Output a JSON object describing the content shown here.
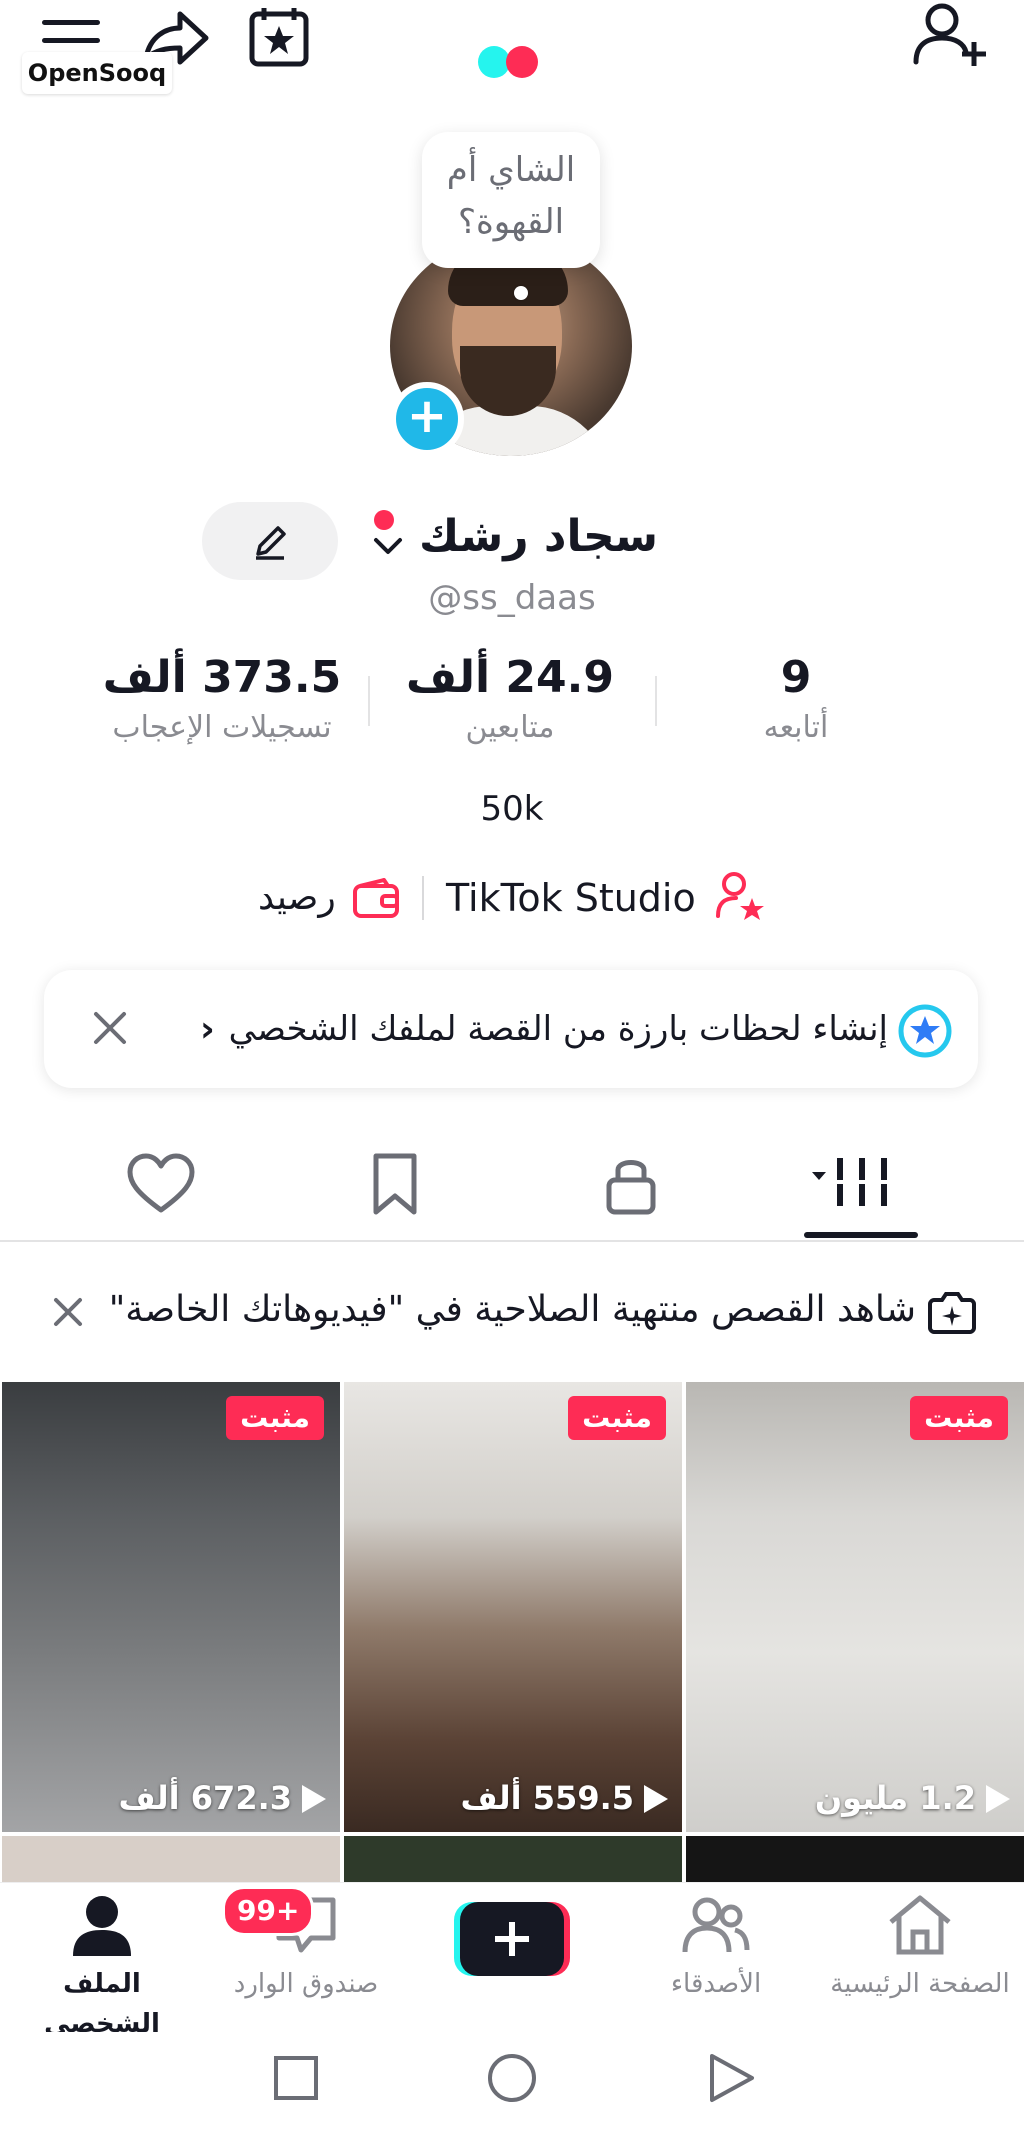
{
  "top_bar": {
    "watermark": "OpenSooq",
    "icons": [
      "menu-icon",
      "share-icon",
      "calendar-star-icon",
      "tiktok-logo",
      "add-friend-icon"
    ]
  },
  "profile": {
    "bubble_text": "الشاي أم القهوة؟",
    "name": "سجاد رشك",
    "username": "@ss_daas",
    "stats": {
      "following_count": "9",
      "following_label": "أتابعه",
      "followers_count": "24.9 ألف",
      "followers_label": "متابعين",
      "likes_count": "373.5 ألف",
      "likes_label": "تسجيلات الإعجاب"
    },
    "bio": "50k",
    "studio_label": "TikTok Studio",
    "balance_label": "رصيد"
  },
  "banner": {
    "text": "إنشاء لحظات بارزة من القصة لملفك الشخصي",
    "chevron": "›"
  },
  "tabs": [
    "videos-grid-icon",
    "lock-icon",
    "bookmark-icon",
    "heart-icon"
  ],
  "notice": {
    "text": "شاهد القصص منتهية الصلاحية في \"فيديوهاتك الخاصة\""
  },
  "videos": [
    {
      "pinned": "مثبت",
      "views": "672.3 ألف"
    },
    {
      "pinned": "مثبت",
      "views": "559.5 ألف"
    },
    {
      "pinned": "مثبت",
      "views": "1.2 مليون"
    }
  ],
  "bottom_nav": {
    "home": "الصفحة الرئيسية",
    "friends": "الأصدقاء",
    "inbox": "صندوق الوارد",
    "inbox_badge": "99+",
    "profile": "الملف الشخصي"
  },
  "colors": {
    "accent_red": "#fe2c55",
    "accent_cyan": "#25f4ee",
    "avatar_plus": "#20b8e8",
    "text": "#161823",
    "muted": "#8a8b91"
  }
}
